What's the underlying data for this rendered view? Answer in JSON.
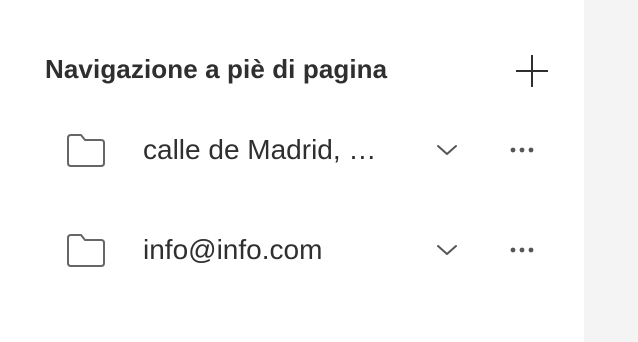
{
  "panel": {
    "title": "Navigazione a piè di pagina",
    "add_icon": "plus-icon",
    "items": [
      {
        "label": "calle de Madrid, …",
        "icon": "folder-icon",
        "expand_icon": "chevron-down-icon",
        "more_icon": "more-horizontal-icon"
      },
      {
        "label": "info@info.com",
        "icon": "folder-icon",
        "expand_icon": "chevron-down-icon",
        "more_icon": "more-horizontal-icon"
      }
    ]
  },
  "colors": {
    "text": "#2f2f2f",
    "icon": "#666666",
    "background": "#ffffff",
    "side_strip": "#f4f4f4"
  }
}
